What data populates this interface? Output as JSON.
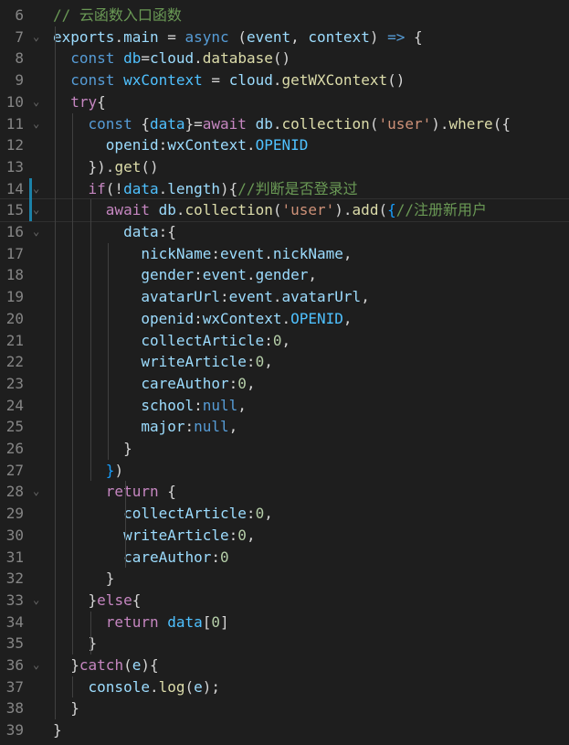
{
  "editor": {
    "lines": [
      {
        "n": "6",
        "fold": "",
        "tokens": [
          [
            "t-comment",
            "// 云函数入口函数"
          ]
        ]
      },
      {
        "n": "7",
        "fold": "⌄",
        "tokens": [
          [
            "t-var",
            "exports"
          ],
          [
            "t-punc",
            "."
          ],
          [
            "t-var",
            "main"
          ],
          [
            "t-punc",
            " = "
          ],
          [
            "t-keyword",
            "async"
          ],
          [
            "t-punc",
            " ("
          ],
          [
            "t-var",
            "event"
          ],
          [
            "t-punc",
            ", "
          ],
          [
            "t-var",
            "context"
          ],
          [
            "t-punc",
            ") "
          ],
          [
            "t-keyword",
            "=>"
          ],
          [
            "t-punc",
            " {"
          ]
        ]
      },
      {
        "n": "8",
        "fold": "",
        "tokens": [
          [
            "t-punc",
            "  "
          ],
          [
            "t-keyword",
            "const"
          ],
          [
            "t-punc",
            " "
          ],
          [
            "t-const",
            "db"
          ],
          [
            "t-punc",
            "="
          ],
          [
            "t-var",
            "cloud"
          ],
          [
            "t-punc",
            "."
          ],
          [
            "t-func",
            "database"
          ],
          [
            "t-punc",
            "()"
          ]
        ]
      },
      {
        "n": "9",
        "fold": "",
        "tokens": [
          [
            "t-punc",
            "  "
          ],
          [
            "t-keyword",
            "const"
          ],
          [
            "t-punc",
            " "
          ],
          [
            "t-const",
            "wxContext"
          ],
          [
            "t-punc",
            " = "
          ],
          [
            "t-var",
            "cloud"
          ],
          [
            "t-punc",
            "."
          ],
          [
            "t-func",
            "getWXContext"
          ],
          [
            "t-punc",
            "()"
          ]
        ]
      },
      {
        "n": "10",
        "fold": "⌄",
        "tokens": [
          [
            "t-punc",
            "  "
          ],
          [
            "t-control",
            "try"
          ],
          [
            "t-punc",
            "{"
          ]
        ]
      },
      {
        "n": "11",
        "fold": "⌄",
        "tokens": [
          [
            "t-punc",
            "    "
          ],
          [
            "t-keyword",
            "const"
          ],
          [
            "t-punc",
            " {"
          ],
          [
            "t-const",
            "data"
          ],
          [
            "t-punc",
            "}="
          ],
          [
            "t-control",
            "await"
          ],
          [
            "t-punc",
            " "
          ],
          [
            "t-var",
            "db"
          ],
          [
            "t-punc",
            "."
          ],
          [
            "t-func",
            "collection"
          ],
          [
            "t-punc",
            "("
          ],
          [
            "t-string",
            "'user'"
          ],
          [
            "t-punc",
            ")."
          ],
          [
            "t-func",
            "where"
          ],
          [
            "t-punc",
            "({"
          ]
        ]
      },
      {
        "n": "12",
        "fold": "",
        "tokens": [
          [
            "t-punc",
            "      "
          ],
          [
            "t-prop",
            "openid"
          ],
          [
            "t-punc",
            ":"
          ],
          [
            "t-var",
            "wxContext"
          ],
          [
            "t-punc",
            "."
          ],
          [
            "t-const",
            "OPENID"
          ]
        ]
      },
      {
        "n": "13",
        "fold": "",
        "tokens": [
          [
            "t-punc",
            "    })."
          ],
          [
            "t-func",
            "get"
          ],
          [
            "t-punc",
            "()"
          ]
        ]
      },
      {
        "n": "14",
        "fold": "⌄",
        "tokens": [
          [
            "t-punc",
            "    "
          ],
          [
            "t-control",
            "if"
          ],
          [
            "t-punc",
            "(!"
          ],
          [
            "t-const",
            "data"
          ],
          [
            "t-punc",
            "."
          ],
          [
            "t-prop",
            "length"
          ],
          [
            "t-punc",
            "){"
          ],
          [
            "t-comment",
            "//判断是否登录过"
          ]
        ]
      },
      {
        "n": "15",
        "fold": "⌄",
        "tokens": [
          [
            "t-punc",
            "      "
          ],
          [
            "t-control",
            "await"
          ],
          [
            "t-punc",
            " "
          ],
          [
            "t-var",
            "db"
          ],
          [
            "t-punc",
            "."
          ],
          [
            "t-func",
            "collection"
          ],
          [
            "t-punc",
            "("
          ],
          [
            "t-string",
            "'user'"
          ],
          [
            "t-punc",
            ")."
          ],
          [
            "t-func",
            "add"
          ],
          [
            "t-punc",
            "("
          ],
          [
            "t-bracket-b",
            "{"
          ],
          [
            "t-comment",
            "//注册新用户"
          ]
        ]
      },
      {
        "n": "16",
        "fold": "⌄",
        "tokens": [
          [
            "t-punc",
            "        "
          ],
          [
            "t-prop",
            "data"
          ],
          [
            "t-punc",
            ":{"
          ]
        ]
      },
      {
        "n": "17",
        "fold": "",
        "tokens": [
          [
            "t-punc",
            "          "
          ],
          [
            "t-prop",
            "nickName"
          ],
          [
            "t-punc",
            ":"
          ],
          [
            "t-var",
            "event"
          ],
          [
            "t-punc",
            "."
          ],
          [
            "t-prop",
            "nickName"
          ],
          [
            "t-punc",
            ","
          ]
        ]
      },
      {
        "n": "18",
        "fold": "",
        "tokens": [
          [
            "t-punc",
            "          "
          ],
          [
            "t-prop",
            "gender"
          ],
          [
            "t-punc",
            ":"
          ],
          [
            "t-var",
            "event"
          ],
          [
            "t-punc",
            "."
          ],
          [
            "t-prop",
            "gender"
          ],
          [
            "t-punc",
            ","
          ]
        ]
      },
      {
        "n": "19",
        "fold": "",
        "tokens": [
          [
            "t-punc",
            "          "
          ],
          [
            "t-prop",
            "avatarUrl"
          ],
          [
            "t-punc",
            ":"
          ],
          [
            "t-var",
            "event"
          ],
          [
            "t-punc",
            "."
          ],
          [
            "t-prop",
            "avatarUrl"
          ],
          [
            "t-punc",
            ","
          ]
        ]
      },
      {
        "n": "20",
        "fold": "",
        "tokens": [
          [
            "t-punc",
            "          "
          ],
          [
            "t-prop",
            "openid"
          ],
          [
            "t-punc",
            ":"
          ],
          [
            "t-var",
            "wxContext"
          ],
          [
            "t-punc",
            "."
          ],
          [
            "t-const",
            "OPENID"
          ],
          [
            "t-punc",
            ","
          ]
        ]
      },
      {
        "n": "21",
        "fold": "",
        "tokens": [
          [
            "t-punc",
            "          "
          ],
          [
            "t-prop",
            "collectArticle"
          ],
          [
            "t-punc",
            ":"
          ],
          [
            "t-number",
            "0"
          ],
          [
            "t-punc",
            ","
          ]
        ]
      },
      {
        "n": "22",
        "fold": "",
        "tokens": [
          [
            "t-punc",
            "          "
          ],
          [
            "t-prop",
            "writeArticle"
          ],
          [
            "t-punc",
            ":"
          ],
          [
            "t-number",
            "0"
          ],
          [
            "t-punc",
            ","
          ]
        ]
      },
      {
        "n": "23",
        "fold": "",
        "tokens": [
          [
            "t-punc",
            "          "
          ],
          [
            "t-prop",
            "careAuthor"
          ],
          [
            "t-punc",
            ":"
          ],
          [
            "t-number",
            "0"
          ],
          [
            "t-punc",
            ","
          ]
        ]
      },
      {
        "n": "24",
        "fold": "",
        "tokens": [
          [
            "t-punc",
            "          "
          ],
          [
            "t-prop",
            "school"
          ],
          [
            "t-punc",
            ":"
          ],
          [
            "t-keyword",
            "null"
          ],
          [
            "t-punc",
            ","
          ]
        ]
      },
      {
        "n": "25",
        "fold": "",
        "tokens": [
          [
            "t-punc",
            "          "
          ],
          [
            "t-prop",
            "major"
          ],
          [
            "t-punc",
            ":"
          ],
          [
            "t-keyword",
            "null"
          ],
          [
            "t-punc",
            ","
          ]
        ]
      },
      {
        "n": "26",
        "fold": "",
        "tokens": [
          [
            "t-punc",
            "        }"
          ]
        ]
      },
      {
        "n": "27",
        "fold": "",
        "tokens": [
          [
            "t-punc",
            "      "
          ],
          [
            "t-bracket-b",
            "}"
          ],
          [
            "t-punc",
            ")"
          ]
        ]
      },
      {
        "n": "28",
        "fold": "⌄",
        "tokens": [
          [
            "t-punc",
            "      "
          ],
          [
            "t-control",
            "return"
          ],
          [
            "t-punc",
            " {"
          ]
        ]
      },
      {
        "n": "29",
        "fold": "",
        "tokens": [
          [
            "t-punc",
            "        "
          ],
          [
            "t-prop",
            "collectArticle"
          ],
          [
            "t-punc",
            ":"
          ],
          [
            "t-number",
            "0"
          ],
          [
            "t-punc",
            ","
          ]
        ]
      },
      {
        "n": "30",
        "fold": "",
        "tokens": [
          [
            "t-punc",
            "        "
          ],
          [
            "t-prop",
            "writeArticle"
          ],
          [
            "t-punc",
            ":"
          ],
          [
            "t-number",
            "0"
          ],
          [
            "t-punc",
            ","
          ]
        ]
      },
      {
        "n": "31",
        "fold": "",
        "tokens": [
          [
            "t-punc",
            "        "
          ],
          [
            "t-prop",
            "careAuthor"
          ],
          [
            "t-punc",
            ":"
          ],
          [
            "t-number",
            "0"
          ]
        ]
      },
      {
        "n": "32",
        "fold": "",
        "tokens": [
          [
            "t-punc",
            "      }"
          ]
        ]
      },
      {
        "n": "33",
        "fold": "⌄",
        "tokens": [
          [
            "t-punc",
            "    }"
          ],
          [
            "t-control",
            "else"
          ],
          [
            "t-punc",
            "{"
          ]
        ]
      },
      {
        "n": "34",
        "fold": "",
        "tokens": [
          [
            "t-punc",
            "      "
          ],
          [
            "t-control",
            "return"
          ],
          [
            "t-punc",
            " "
          ],
          [
            "t-const",
            "data"
          ],
          [
            "t-punc",
            "["
          ],
          [
            "t-number",
            "0"
          ],
          [
            "t-punc",
            "]"
          ]
        ]
      },
      {
        "n": "35",
        "fold": "",
        "tokens": [
          [
            "t-punc",
            "    }"
          ]
        ]
      },
      {
        "n": "36",
        "fold": "⌄",
        "tokens": [
          [
            "t-punc",
            "  }"
          ],
          [
            "t-control",
            "catch"
          ],
          [
            "t-punc",
            "("
          ],
          [
            "t-var",
            "e"
          ],
          [
            "t-punc",
            "){"
          ]
        ]
      },
      {
        "n": "37",
        "fold": "",
        "tokens": [
          [
            "t-punc",
            "    "
          ],
          [
            "t-var",
            "console"
          ],
          [
            "t-punc",
            "."
          ],
          [
            "t-func",
            "log"
          ],
          [
            "t-punc",
            "("
          ],
          [
            "t-var",
            "e"
          ],
          [
            "t-punc",
            ");"
          ]
        ]
      },
      {
        "n": "38",
        "fold": "",
        "tokens": [
          [
            "t-punc",
            "  }"
          ]
        ]
      },
      {
        "n": "39",
        "fold": "",
        "tokens": [
          [
            "t-punc",
            "}"
          ]
        ]
      }
    ]
  }
}
